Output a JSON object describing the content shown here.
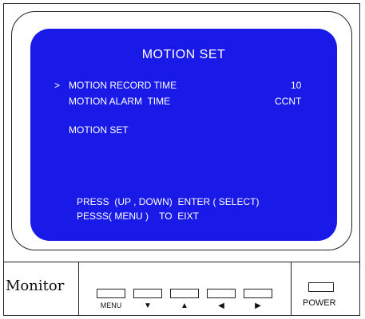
{
  "screen": {
    "title": "MOTION SET",
    "cursor": ">",
    "items": [
      {
        "label": "MOTION RECORD TIME",
        "value": "10"
      },
      {
        "label": "MOTION ALARM  TIME",
        "value": "CCNT"
      },
      {
        "label": "MOTION SET",
        "value": ""
      }
    ],
    "instruction_1": "PRESS  (UP , DOWN)  ENTER ( SELECT)",
    "instruction_2": "PESSS( MENU )    TO  EIXT"
  },
  "panel": {
    "monitor_label": "Monitor",
    "buttons": [
      {
        "label": "MENU"
      },
      {
        "label": "▼"
      },
      {
        "label": "▲"
      },
      {
        "label": "◀"
      },
      {
        "label": "▶"
      }
    ],
    "power_label": "POWER"
  },
  "colors": {
    "screen_bg": "#1a1ae8",
    "text": "#ffffff"
  }
}
